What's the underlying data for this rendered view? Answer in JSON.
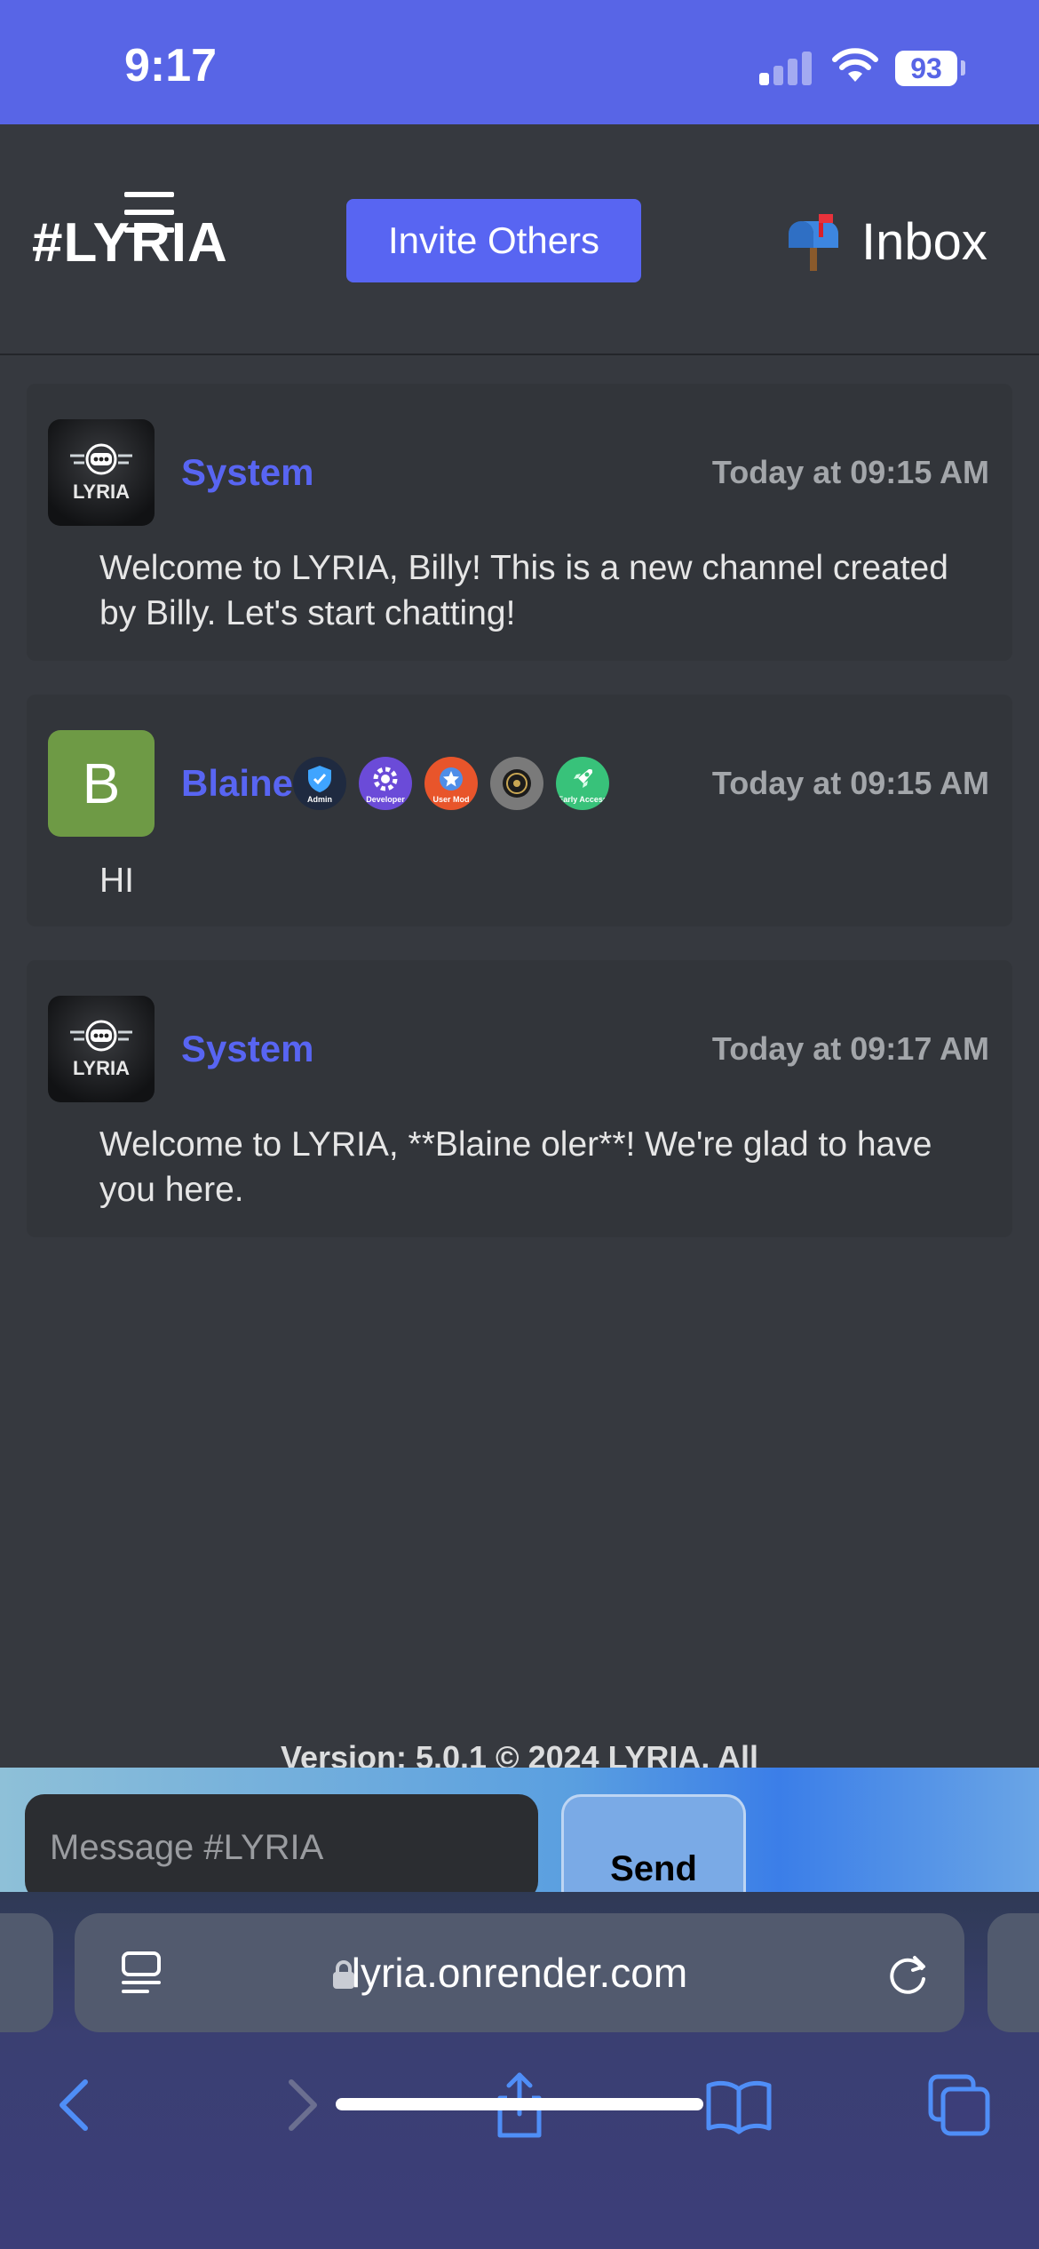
{
  "status_bar": {
    "time": "9:17",
    "battery": "93",
    "icons": [
      "signal-icon",
      "wifi-icon",
      "battery-icon"
    ]
  },
  "header": {
    "brand": "#LYRIA",
    "invite_label": "Invite Others",
    "inbox_label": "Inbox",
    "icons": [
      "menu-icon",
      "mailbox-icon"
    ]
  },
  "messages": [
    {
      "author": "System",
      "avatar": "lyria-logo",
      "timestamp": "Today at 09:15 AM",
      "text": "Welcome to LYRIA, Billy! This is a new channel created by Billy. Let's start chatting!"
    },
    {
      "author": "Blaine",
      "avatar_letter": "B",
      "timestamp": "Today at 09:15 AM",
      "text": "HI",
      "badges": [
        {
          "name": "admin-badge",
          "label": "Admin",
          "color": "#2b3a55"
        },
        {
          "name": "developer-badge",
          "label": "Developer",
          "color": "#6b4bd8"
        },
        {
          "name": "user-mod-badge",
          "label": "User Mod",
          "color": "#e8552b"
        },
        {
          "name": "dark-badge",
          "label": "",
          "color": "#6f6f6f"
        },
        {
          "name": "early-access-badge",
          "label": "Early Access",
          "color": "#38c27a"
        }
      ]
    },
    {
      "author": "System",
      "avatar": "lyria-logo",
      "timestamp": "Today at 09:17 AM",
      "text": "Welcome to LYRIA, **Blaine oler**! We're glad to have you here."
    }
  ],
  "footer": {
    "version": "Version: 5.0.1 © 2024 LYRIA. All"
  },
  "composer": {
    "placeholder": "Message #LYRIA",
    "send_label": "Send"
  },
  "browser": {
    "url": "lyria.onrender.com",
    "icons": [
      "tabs-icon",
      "lock-icon",
      "reload-icon",
      "back-icon",
      "forward-icon",
      "share-icon",
      "bookmarks-icon",
      "tab-switcher-icon"
    ]
  },
  "colors": {
    "status_bar": "#5865e6",
    "accent": "#5865f2",
    "background": "#36393f",
    "card": "#32353a"
  }
}
